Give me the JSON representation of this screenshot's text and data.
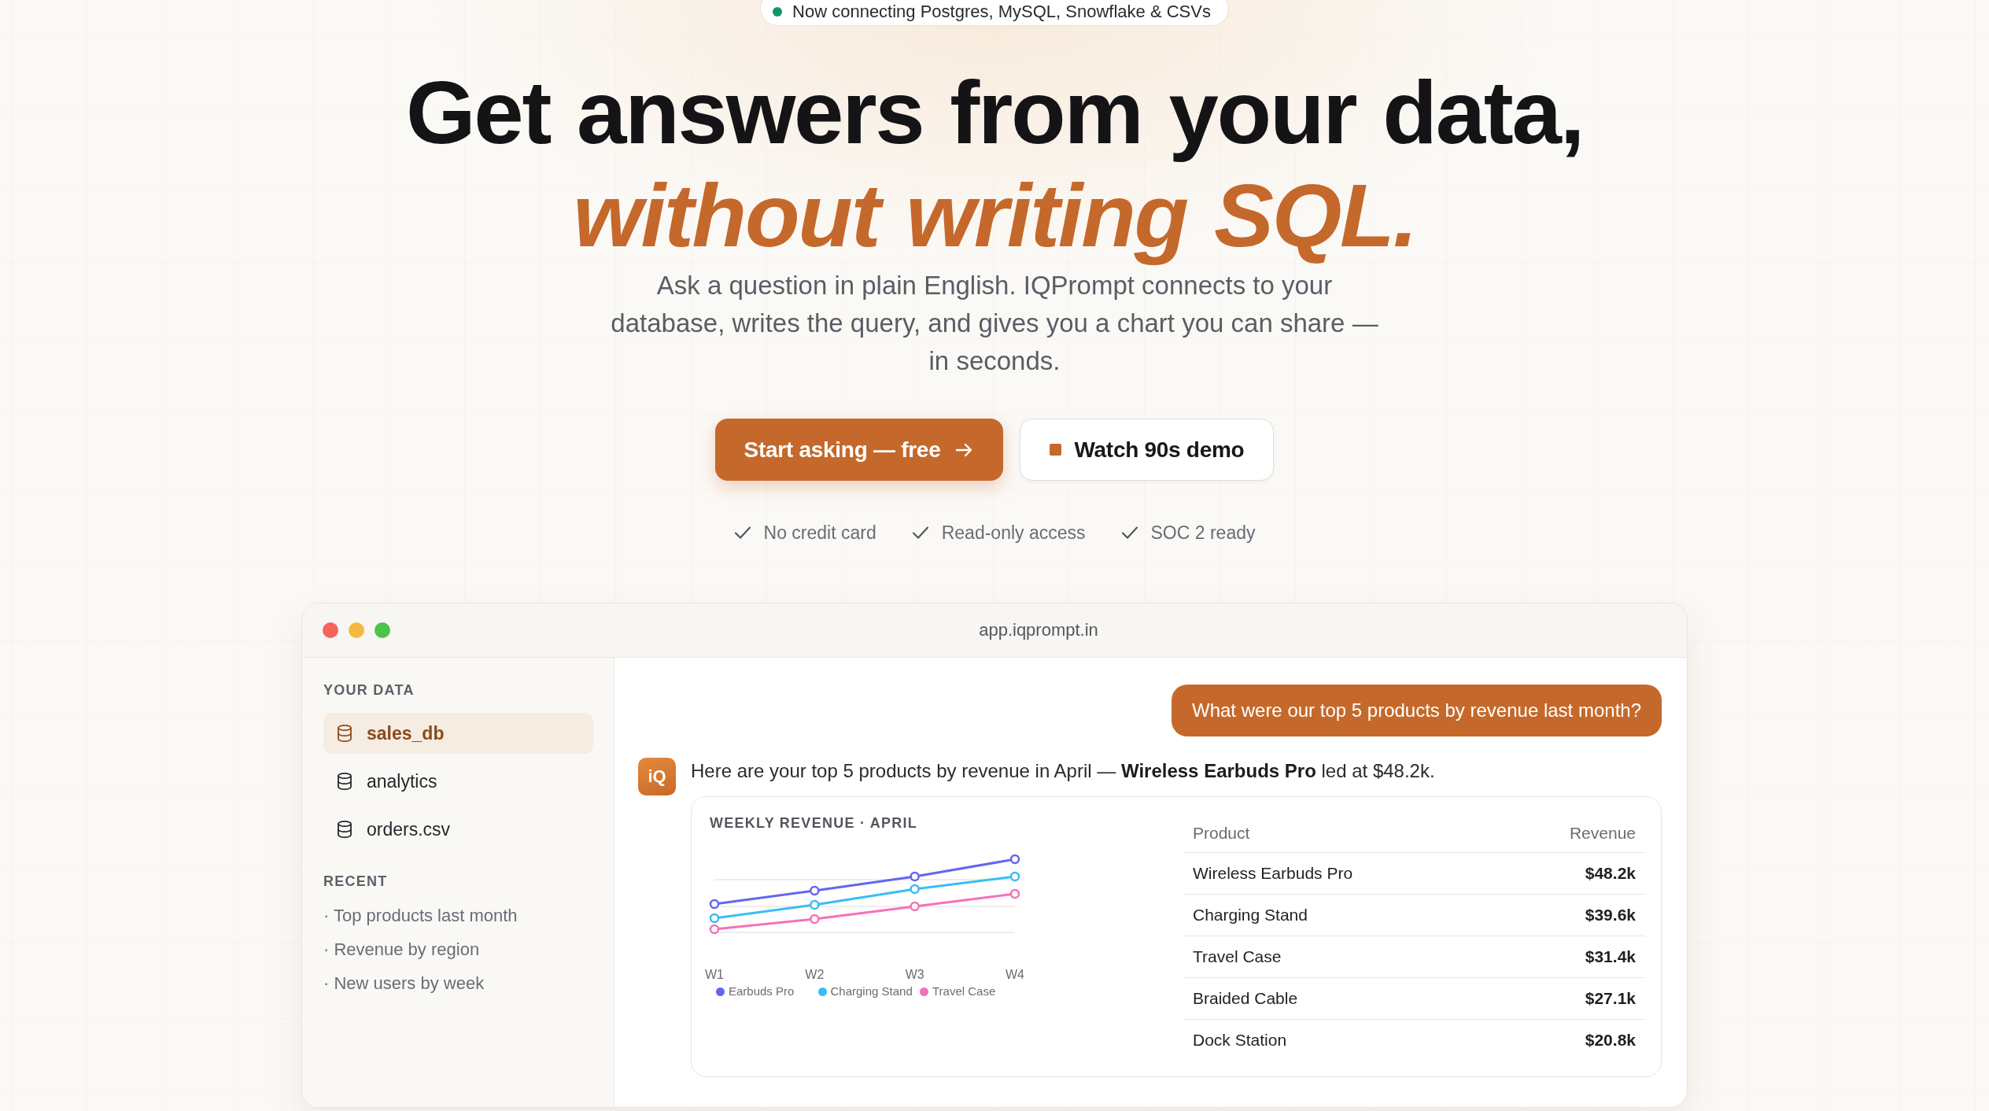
{
  "announcement": {
    "text": "Now connecting Postgres, MySQL, Snowflake & CSVs"
  },
  "hero": {
    "headline": "Get answers from your data,",
    "headline_accent": "without writing SQL.",
    "subtitle_lines": [
      "Ask a question in plain English. IQPrompt connects to your",
      "database, writes the query, and gives you a chart you can share —",
      "in seconds."
    ]
  },
  "buttons": [
    {
      "kind": "primary",
      "label": "Start asking — free"
    },
    {
      "kind": "secondary",
      "label": "Watch 90s demo"
    }
  ],
  "assurances": [
    "No credit card",
    "Read-only access",
    "SOC 2 ready"
  ],
  "app_window": {
    "url": "app.iqprompt.in",
    "sidebar": {
      "sections": [
        {
          "kind": "sources",
          "heading": "YOUR DATA",
          "items": [
            {
              "label": "sales_db",
              "selected": true
            },
            {
              "label": "analytics",
              "selected": false
            },
            {
              "label": "orders.csv",
              "selected": false
            }
          ]
        },
        {
          "kind": "recent",
          "heading": "RECENT",
          "items": [
            {
              "label": "· Top products last month"
            },
            {
              "label": "· Revenue by region"
            },
            {
              "label": "· New users by week"
            }
          ]
        }
      ]
    },
    "chat": {
      "question": "What were our top 5 products by revenue last month?",
      "avatar": "iQ",
      "answer": "Here are your top 5 products by revenue in April — **Wireless Earbuds Pro** led at $48.2k.",
      "chart": {
        "title": "WEEKLY REVENUE · APRIL",
        "x_labels": [
          "W1",
          "W2",
          "W3",
          "W4"
        ],
        "series": [
          {
            "name": "Earbuds Pro",
            "color": "#6366f1"
          },
          {
            "name": "Charging Stand",
            "color": "#38bdf8"
          },
          {
            "name": "Travel Case",
            "color": "#f472b6"
          }
        ]
      },
      "table": {
        "columns": [
          "Product",
          "Revenue"
        ],
        "rows": [
          [
            "Wireless Earbuds Pro",
            "$48.2k"
          ],
          [
            "Charging Stand",
            "$39.6k"
          ],
          [
            "Travel Case",
            "$31.4k"
          ],
          [
            "Braided Cable",
            "$27.1k"
          ],
          [
            "Dock Station",
            "$20.8k"
          ]
        ]
      }
    }
  }
}
